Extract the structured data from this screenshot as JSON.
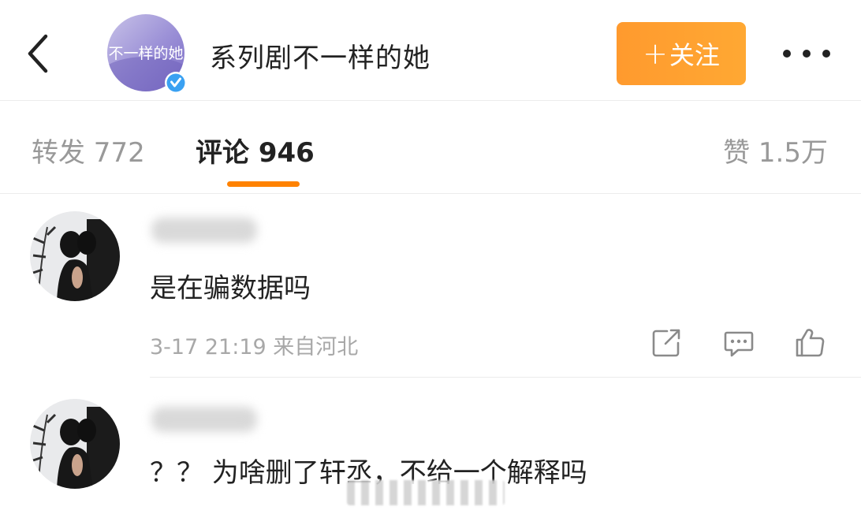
{
  "header": {
    "title": "系列剧不一样的她",
    "avatar_text": "不一样的她",
    "follow_label": "关注",
    "follow_plus": "+",
    "verified": true,
    "accent": "#ff9a2e"
  },
  "tabs": {
    "repost_label": "转发 772",
    "comments_label": "评论 946",
    "likes_label": "赞 1.5万",
    "active": "comments",
    "indicator_color": "#ff8200"
  },
  "comments": [
    {
      "text": "是在骗数据吗",
      "meta": "3-17 21:19 来自河北"
    },
    {
      "text": "？？ 为啥删了轩丞，不给一个解释吗"
    }
  ],
  "icons": {
    "back": "chevron-left-icon",
    "more": "more-dots-icon",
    "share": "share-icon",
    "reply": "comment-icon",
    "like": "thumbs-up-icon"
  }
}
